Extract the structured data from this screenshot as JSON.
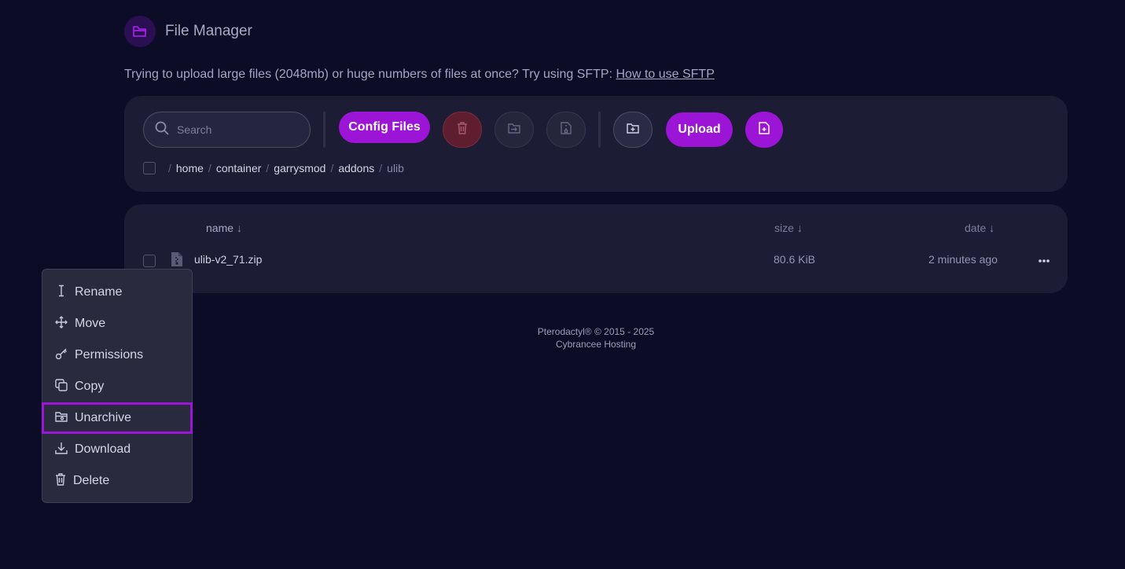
{
  "header": {
    "title": "File Manager",
    "icon": "folder-open-icon"
  },
  "notice": {
    "text": "Trying to upload large files (2048mb) or huge numbers of files at once? Try using SFTP: ",
    "link": "How to use SFTP"
  },
  "toolbar": {
    "search_placeholder": "Search",
    "config_files_label": "Config Files",
    "upload_label": "Upload",
    "icons": [
      "search-icon",
      "trash-icon",
      "move-icon",
      "archive-icon",
      "folder-plus-icon",
      "file-plus-icon"
    ]
  },
  "breadcrumb": {
    "root_sep": "/",
    "parts": [
      "home",
      "container",
      "garrysmod",
      "addons",
      "ulib"
    ],
    "sep": "/"
  },
  "list": {
    "columns": {
      "name": "name",
      "size": "size",
      "date": "date",
      "sort_arrow": "↓"
    },
    "rows": [
      {
        "name": "ulib-v2_71.zip",
        "size": "80.6 KiB",
        "date": "2 minutes ago",
        "icon": "file-zip-icon"
      }
    ]
  },
  "footer": {
    "line1": "Pterodactyl® © 2015 - 2025",
    "line2": "Cybrancee Hosting"
  },
  "context_menu": {
    "items": [
      {
        "label": "Rename",
        "icon": "text-cursor-icon"
      },
      {
        "label": "Move",
        "icon": "move-arrows-icon"
      },
      {
        "label": "Permissions",
        "icon": "key-icon"
      },
      {
        "label": "Copy",
        "icon": "copy-icon"
      },
      {
        "label": "Unarchive",
        "icon": "folder-open-icon",
        "highlighted": true
      },
      {
        "label": "Download",
        "icon": "download-icon"
      },
      {
        "label": "Delete",
        "icon": "trash-icon"
      }
    ]
  },
  "colors": {
    "background": "#0c0c27",
    "card": "#1c1c35",
    "accent": "#9c14d6",
    "danger": "#5e1e30"
  }
}
